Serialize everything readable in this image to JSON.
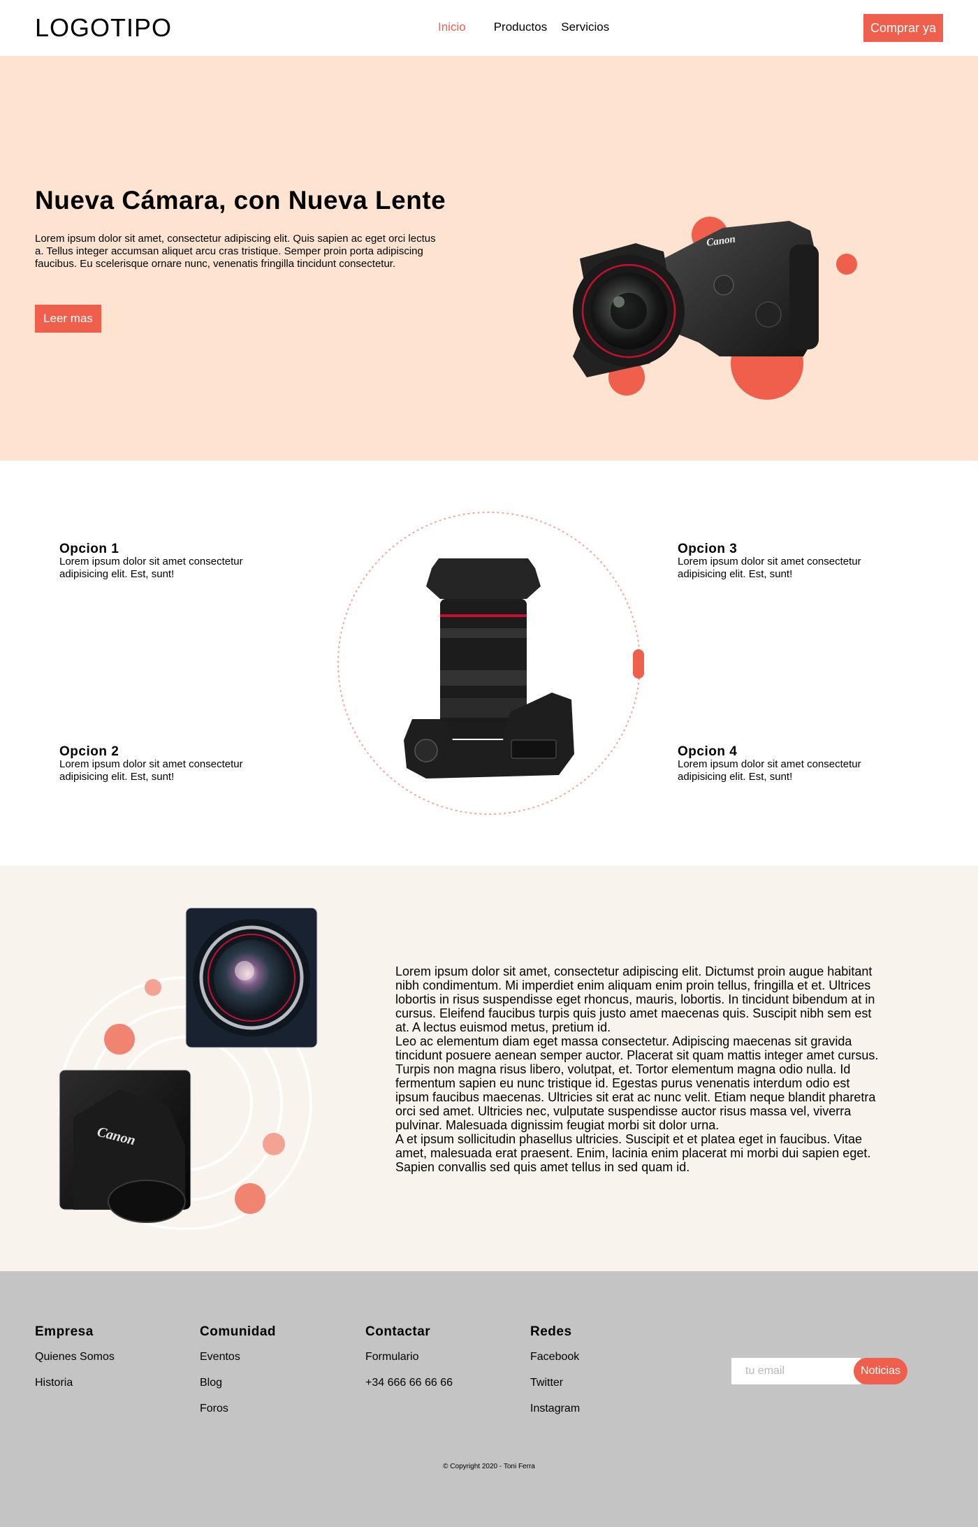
{
  "header": {
    "logo": "LOGOTIPO",
    "nav": [
      "Inicio",
      "Productos",
      "Servicios"
    ],
    "cta": "Comprar ya"
  },
  "hero": {
    "title": "Nueva Cámara, con Nueva Lente",
    "text": "Lorem ipsum dolor sit amet, consectetur adipiscing elit. Quis sapien ac eget orci lectus a. Tellus integer accumsan aliquet arcu cras tristique. Semper proin porta adipiscing faucibus. Eu scelerisque ornare nunc, venenatis fringilla tincidunt consectetur.",
    "button": "Leer mas",
    "camera_brand": "Canon"
  },
  "features": {
    "options": [
      {
        "title": "Opcion 1",
        "text": "Lorem ipsum dolor sit amet consectetur adipisicing elit. Est, sunt!"
      },
      {
        "title": "Opcion 2",
        "text": "Lorem ipsum dolor sit amet consectetur adipisicing elit. Est, sunt!"
      },
      {
        "title": "Opcion 3",
        "text": "Lorem ipsum dolor sit amet consectetur adipisicing elit. Est, sunt!"
      },
      {
        "title": "Opcion 4",
        "text": "Lorem ipsum dolor sit amet consectetur adipisicing elit. Est, sunt!"
      }
    ]
  },
  "about": {
    "paragraphs": [
      "Lorem ipsum dolor sit amet, consectetur adipiscing elit. Dictumst proin augue habitant nibh condimentum. Mi imperdiet enim aliquam enim proin tellus, fringilla et et. Ultrices lobortis in risus suspendisse eget rhoncus, mauris, lobortis. In tincidunt bibendum at in cursus. Eleifend faucibus turpis quis justo amet maecenas quis. Suscipit nibh sem est at. A lectus euismod metus, pretium id.",
      "Leo ac elementum diam eget massa consectetur. Adipiscing maecenas sit gravida tincidunt posuere aenean semper auctor. Placerat sit quam mattis integer amet cursus. Turpis non magna risus libero, volutpat, et. Tortor elementum magna odio nulla. Id fermentum sapien eu nunc tristique id. Egestas purus venenatis interdum odio est ipsum faucibus maecenas. Ultricies sit erat ac nunc velit. Etiam neque blandit pharetra orci sed amet. Ultricies nec, vulputate suspendisse auctor risus massa vel, viverra pulvinar. Malesuada dignissim feugiat morbi sit dolor urna.",
      "A et ipsum sollicitudin phasellus ultricies. Suscipit et et platea eget in faucibus. Vitae amet, malesuada erat praesent. Enim, lacinia enim placerat mi morbi dui sapien eget. Sapien convallis sed quis amet tellus in sed quam id."
    ],
    "photo_brand": "Canon"
  },
  "footer": {
    "columns": [
      {
        "title": "Empresa",
        "links": [
          "Quienes Somos",
          "Historia"
        ]
      },
      {
        "title": "Comunidad",
        "links": [
          "Eventos",
          "Blog",
          "Foros"
        ]
      },
      {
        "title": "Contactar",
        "links": [
          "Formulario",
          "+34 666 66 66 66"
        ]
      },
      {
        "title": "Redes",
        "links": [
          "Facebook",
          "Twitter",
          "Instagram"
        ]
      }
    ],
    "newsletter": {
      "placeholder": "tu email",
      "button": "Noticias"
    },
    "copyright": "© Copyright 2020 - Toni Ferra"
  },
  "colors": {
    "accent": "#ef5f4b",
    "hero_bg": "#fee4d0",
    "about_bg": "#f8f3ec",
    "footer_bg": "#c4c4c4"
  }
}
